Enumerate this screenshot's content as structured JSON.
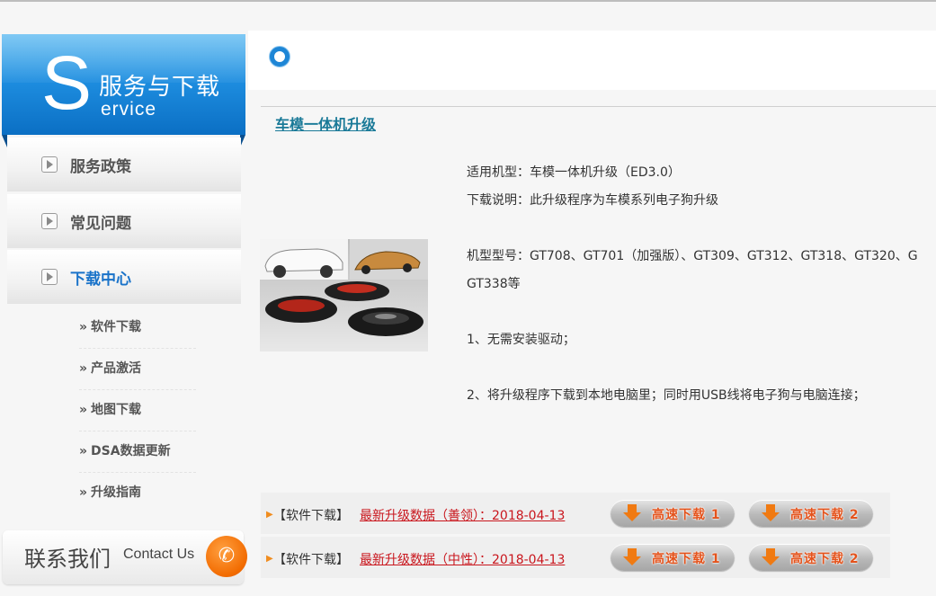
{
  "sidebar": {
    "header_letter": "S",
    "header_title": "服务与下载",
    "header_sub": "ervice",
    "menu": [
      {
        "label": "服务政策"
      },
      {
        "label": "常见问题"
      },
      {
        "label": "下载中心"
      }
    ],
    "submenu": [
      {
        "label": "软件下载"
      },
      {
        "label": "产品激活"
      },
      {
        "label": "地图下载"
      },
      {
        "label": "DSA数据更新"
      },
      {
        "label": "升级指南"
      }
    ],
    "submenu_chevron": "»",
    "contact_cn": "联系我们",
    "contact_en": "Contact Us"
  },
  "main": {
    "section_title": "车模一体机升级",
    "info": {
      "model": "适用机型：车模一体机升级（ED3.0）",
      "desc": "下载说明：此升级程序为车模系列电子狗升级",
      "models_line1": "机型型号：GT708、GT701（加强版）、GT309、GT312、GT318、GT320、G",
      "models_line2": "GT338等",
      "step1": "1、无需安装驱动；",
      "step2": "2、将升级程序下载到本地电脑里；同时用USB线将电子狗与电脑连接；"
    },
    "downloads": [
      {
        "tag": "【软件下载】",
        "link": "最新升级数据（善领）：2018-04-13",
        "btn1": "高速下载 1",
        "btn2": "高速下载 2"
      },
      {
        "tag": "【软件下载】",
        "link": "最新升级数据（中性）：2018-04-13",
        "btn1": "高速下载 1",
        "btn2": "高速下载 2"
      }
    ]
  },
  "colors": {
    "accent_blue": "#1a73c9",
    "link_red": "#c9161d",
    "title_teal": "#1a7a98",
    "button_orange": "#f07a12"
  }
}
